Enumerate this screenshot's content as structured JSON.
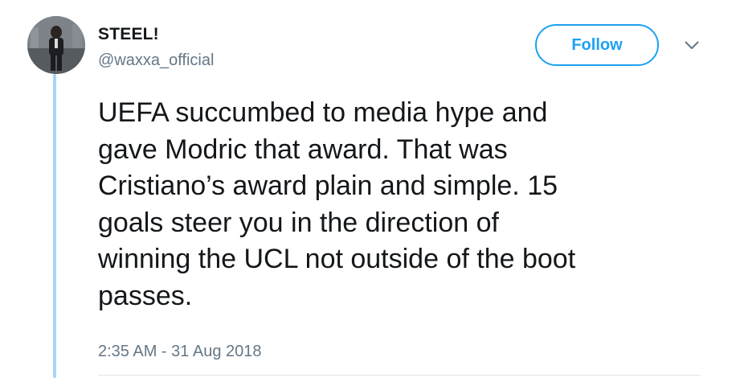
{
  "tweet": {
    "author": {
      "display_name": "STEEL!",
      "handle": "@waxxa_official",
      "avatar_icon": "user-avatar-icon"
    },
    "follow_label": "Follow",
    "menu_icon": "chevron-down-icon",
    "text": "UEFA succumbed to media hype and\ngave Modric that award. That was\nCristiano’s award plain and simple. 15\ngoals steer you in the direction of\nwinning the UCL not outside of the boot\npasses.",
    "timestamp": "2:35 AM - 31 Aug 2018"
  },
  "colors": {
    "accent": "#1da1f2",
    "thread_line": "#a9d4f5",
    "secondary_text": "#657786",
    "primary_text": "#14171a"
  }
}
